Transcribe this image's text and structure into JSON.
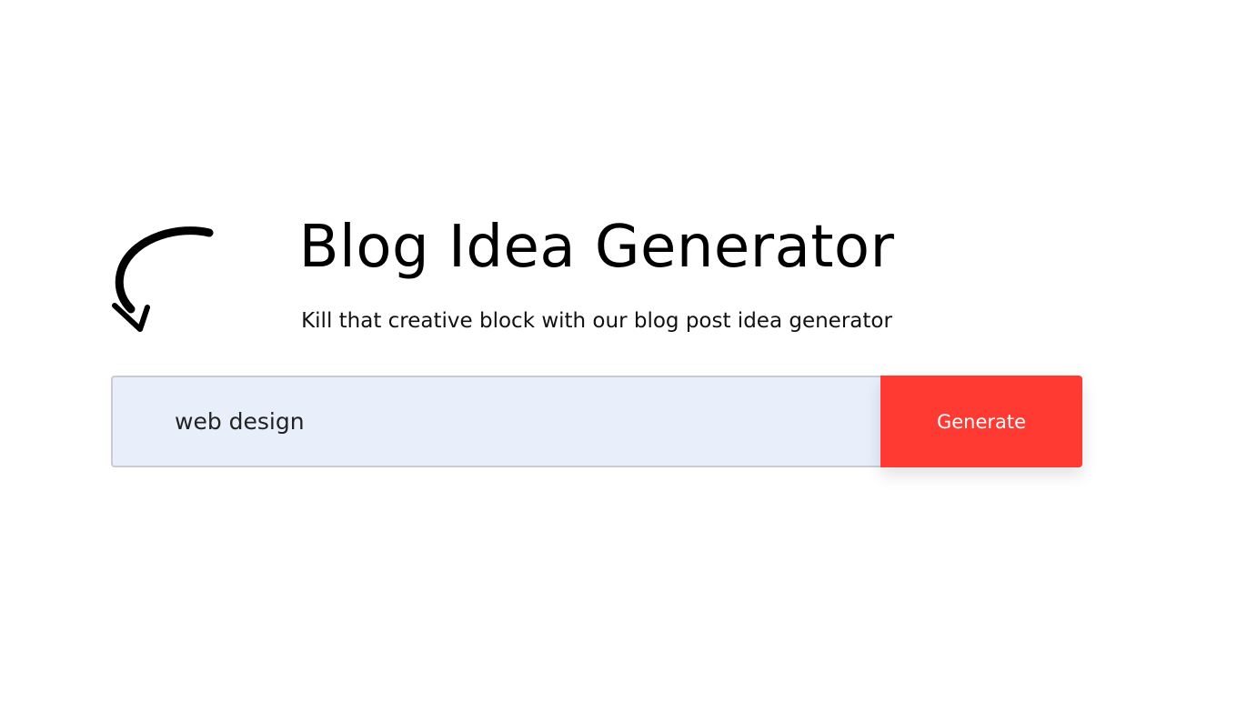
{
  "header": {
    "title": "Blog Idea Generator",
    "subtitle": "Kill that creative block with our blog post idea generator"
  },
  "decoration": {
    "arrow_icon": "curved-arrow-down-icon"
  },
  "form": {
    "input_value": "web design",
    "button_label": "Generate"
  },
  "colors": {
    "accent": "#ff3a33",
    "input_background": "#e8eefa"
  }
}
